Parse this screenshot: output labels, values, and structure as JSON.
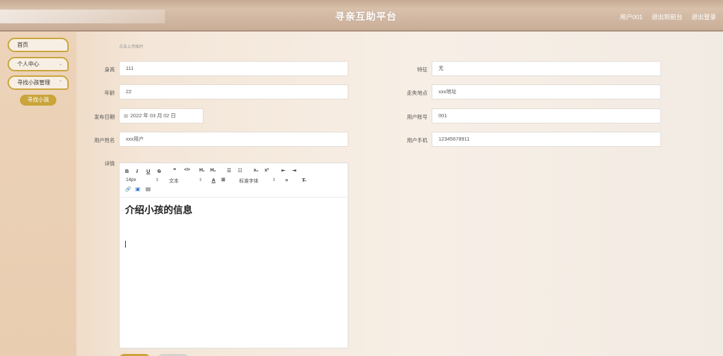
{
  "header": {
    "title": "寻亲互助平台",
    "links": [
      "用户001",
      "退出到前台",
      "退出登录"
    ]
  },
  "sidebar": {
    "items": [
      {
        "label": "首页",
        "has_arrow": false
      },
      {
        "label": "个人中心",
        "has_arrow": true
      },
      {
        "label": "寻找小孩管理",
        "has_arrow": true
      }
    ],
    "active_sub": "寻找小孩"
  },
  "form": {
    "upload_hint": "点击上传图片",
    "left_fields": [
      {
        "label": "身高",
        "value": "111"
      },
      {
        "label": "年龄",
        "value": "22"
      },
      {
        "label": "发布日期",
        "value": "2022 年 03 月 02 日"
      },
      {
        "label": "用户姓名",
        "value": "xxx用户"
      }
    ],
    "right_fields": [
      {
        "label": "特征",
        "value": "无"
      },
      {
        "label": "走失地点",
        "value": "xxx地址"
      },
      {
        "label": "用户账号",
        "value": "001"
      },
      {
        "label": "用户手机",
        "value": "12345678911"
      }
    ],
    "detail_label": "详情"
  },
  "editor": {
    "font_size": "14px",
    "block_type": "文本",
    "font_family": "标准字体",
    "content_heading": "介绍小孩的信息"
  }
}
